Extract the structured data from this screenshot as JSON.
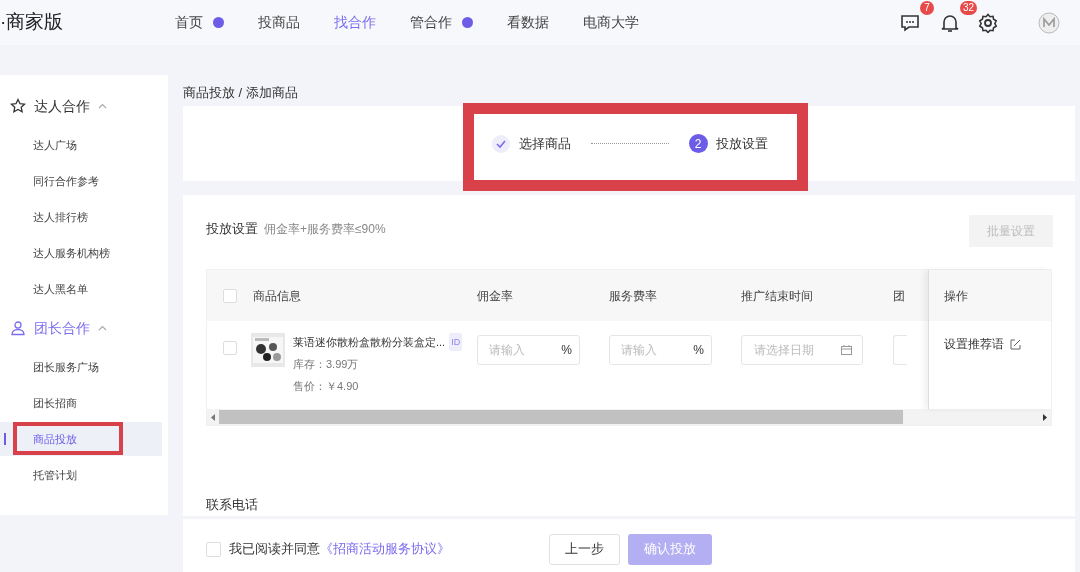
{
  "header": {
    "brand": "·商家版",
    "nav": [
      {
        "label": "首页",
        "selected": false,
        "dot": true
      },
      {
        "label": "投商品",
        "selected": false,
        "dot": false
      },
      {
        "label": "找合作",
        "selected": true,
        "dot": false
      },
      {
        "label": "管合作",
        "selected": false,
        "dot": true
      },
      {
        "label": "看数据",
        "selected": false,
        "dot": false
      },
      {
        "label": "电商大学",
        "selected": false,
        "dot": false
      }
    ],
    "message_count": "7",
    "notification_count": "32"
  },
  "sidebar": {
    "groups": [
      {
        "title": "达人合作",
        "active": false,
        "expanded": true,
        "items": [
          {
            "label": "达人广场",
            "selected": false,
            "highlighted": false
          },
          {
            "label": "同行合作参考",
            "selected": false,
            "highlighted": false
          },
          {
            "label": "达人排行榜",
            "selected": false,
            "highlighted": false
          },
          {
            "label": "达人服务机构榜",
            "selected": false,
            "highlighted": false
          },
          {
            "label": "达人黑名单",
            "selected": false,
            "highlighted": false
          }
        ]
      },
      {
        "title": "团长合作",
        "active": true,
        "expanded": true,
        "items": [
          {
            "label": "团长服务广场",
            "selected": false,
            "highlighted": false
          },
          {
            "label": "团长招商",
            "selected": false,
            "highlighted": false
          },
          {
            "label": "商品投放",
            "selected": true,
            "highlighted": true
          },
          {
            "label": "托管计划",
            "selected": false,
            "highlighted": false
          }
        ]
      }
    ]
  },
  "breadcrumb": "商品投放 / 添加商品",
  "steps": {
    "highlighted": true,
    "items": [
      {
        "label": "选择商品",
        "done": true
      },
      {
        "label": "投放设置",
        "number": "2",
        "done": false
      }
    ]
  },
  "settings": {
    "title": "投放设置",
    "hint": "佣金率+服务费率≤90%",
    "batch_button": "批量设置",
    "table": {
      "select_all_checked": false,
      "columns": [
        "商品信息",
        "佣金率",
        "服务费率",
        "推广结束时间",
        "团"
      ],
      "action_column": "操作",
      "rows": [
        {
          "checked": false,
          "name": "莱语迷你散粉盒散粉分装盒定...",
          "id_tag": "ID",
          "stock": "库存：3.99万",
          "price": "售价：￥4.90",
          "commission": {
            "placeholder": "请输入",
            "unit": "%"
          },
          "service_fee": {
            "placeholder": "请输入",
            "unit": "%"
          },
          "end_date": {
            "placeholder": "请选择日期"
          },
          "action": "设置推荐语"
        }
      ]
    }
  },
  "contact_title": "联系电话",
  "footer": {
    "agree_checked": false,
    "agree_text": "我已阅读并同意",
    "agreement_link": "《招商活动服务协议》",
    "prev_button": "上一步",
    "confirm_button": "确认投放",
    "confirm_disabled": true
  }
}
